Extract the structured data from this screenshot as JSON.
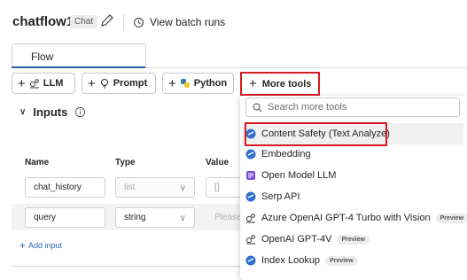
{
  "header": {
    "title": "chatflow1",
    "badge": "Chat",
    "batch_label": "View batch runs"
  },
  "tabs": {
    "flow": "Flow"
  },
  "toolbar": {
    "llm": "LLM",
    "prompt": "Prompt",
    "python": "Python",
    "more_tools": "More tools"
  },
  "inputs": {
    "title": "Inputs",
    "columns": {
      "name": "Name",
      "type": "Type",
      "value": "Value"
    },
    "rows": [
      {
        "name": "chat_history",
        "type": "list",
        "value": "[]"
      },
      {
        "name": "query",
        "type": "string",
        "value": "Please"
      }
    ],
    "add_label": "Add input"
  },
  "dropdown": {
    "search_placeholder": "Search more tools",
    "items": [
      {
        "label": "Content Safety (Text Analyze)",
        "icon": "azure-icon"
      },
      {
        "label": "Embedding",
        "icon": "azure-icon"
      },
      {
        "label": "Open Model LLM",
        "icon": "model-icon"
      },
      {
        "label": "Serp API",
        "icon": "azure-icon"
      },
      {
        "label": "Azure OpenAI GPT-4 Turbo with Vision",
        "icon": "openai-icon",
        "tag": "Preview"
      },
      {
        "label": "OpenAI GPT-4V",
        "icon": "openai-icon",
        "tag": "Preview"
      },
      {
        "label": "Index Lookup",
        "icon": "azure-icon",
        "tag": "Preview"
      }
    ]
  },
  "colors": {
    "accent": "#2b5ea8",
    "highlight_border": "#d71920"
  }
}
